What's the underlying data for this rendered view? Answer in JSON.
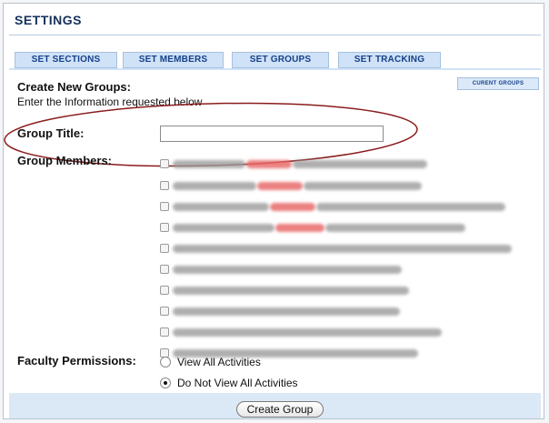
{
  "page": {
    "title": "SETTINGS"
  },
  "tabs": [
    {
      "label": "SET SECTIONS"
    },
    {
      "label": "SET MEMBERS"
    },
    {
      "label": "SET GROUPS"
    },
    {
      "label": "SET TRACKING"
    }
  ],
  "current_groups_button": "CURENT GROUPS",
  "form": {
    "heading": "Create New Groups:",
    "subtext": "Enter the Information requested below",
    "group_title_label": "Group Title:",
    "group_title_value": "",
    "group_members_label": "Group Members:",
    "faculty_permissions_label": "Faculty Permissions:",
    "permission_options": [
      {
        "label": "View All Activities",
        "selected": false
      },
      {
        "label": "Do Not View All Activities",
        "selected": true
      }
    ],
    "submit_label": "Create Group"
  },
  "annotation": {
    "color": "#8a1c1c"
  }
}
